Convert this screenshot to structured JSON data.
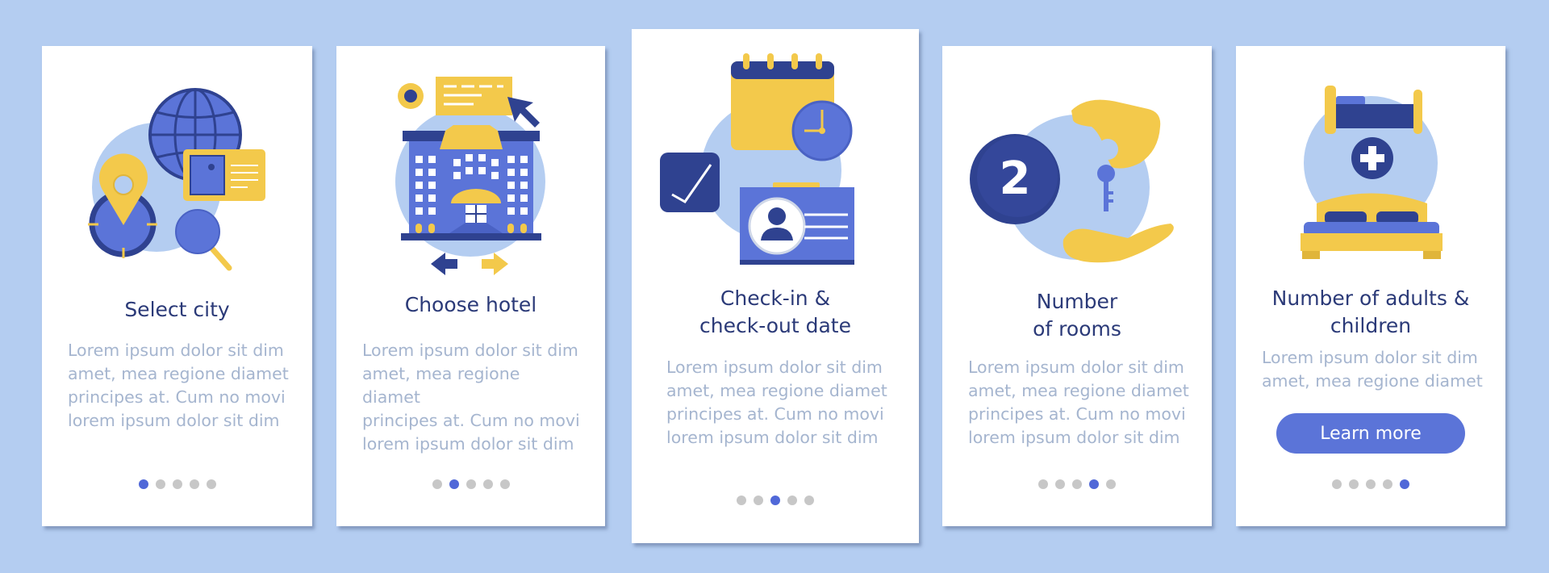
{
  "colors": {
    "background": "#b4cdf1",
    "card": "#ffffff",
    "title": "#2b3a78",
    "body_text": "#a5b5cf",
    "dot_inactive": "#c7c7c7",
    "dot_active": "#5068d8",
    "button": "#5b74d8",
    "illustration_navy": "#2f4290",
    "illustration_blue": "#5b74d8",
    "illustration_yellow": "#f3c94b",
    "illustration_circle": "#b4cdf1"
  },
  "screens": [
    {
      "title": "Select city",
      "body": "Lorem ipsum dolor sit dim\namet, mea regione diamet\nprincipes at. Cum no movi\nlorem ipsum dolor sit dim",
      "icon": "globe-location-search-icon",
      "active_dot": 1,
      "total_dots": 5
    },
    {
      "title": "Choose hotel",
      "body": "Lorem ipsum dolor sit dim\namet, mea regione diamet\nprincipes at. Cum no movi\nlorem ipsum dolor sit dim",
      "icon": "hotel-building-icon",
      "active_dot": 2,
      "total_dots": 5
    },
    {
      "title": "Check-in &\ncheck-out date",
      "body": "Lorem ipsum dolor sit dim\namet, mea regione diamet\nprincipes at. Cum no movi\nlorem ipsum dolor sit dim",
      "icon": "calendar-clock-id-card-icon",
      "active_dot": 3,
      "total_dots": 5
    },
    {
      "title": "Number\nof rooms",
      "body": "Lorem ipsum dolor sit dim\namet, mea regione diamet\nprincipes at. Cum no movi\nlorem ipsum dolor sit dim",
      "icon": "room-key-handover-icon",
      "badge_number": "2",
      "active_dot": 4,
      "total_dots": 5
    },
    {
      "title": "Number of adults &\nchildren",
      "body": "Lorem ipsum dolor sit dim\namet, mea regione diamet",
      "icon": "bed-plus-icon",
      "button_label": "Learn more",
      "active_dot": 5,
      "total_dots": 5
    }
  ]
}
